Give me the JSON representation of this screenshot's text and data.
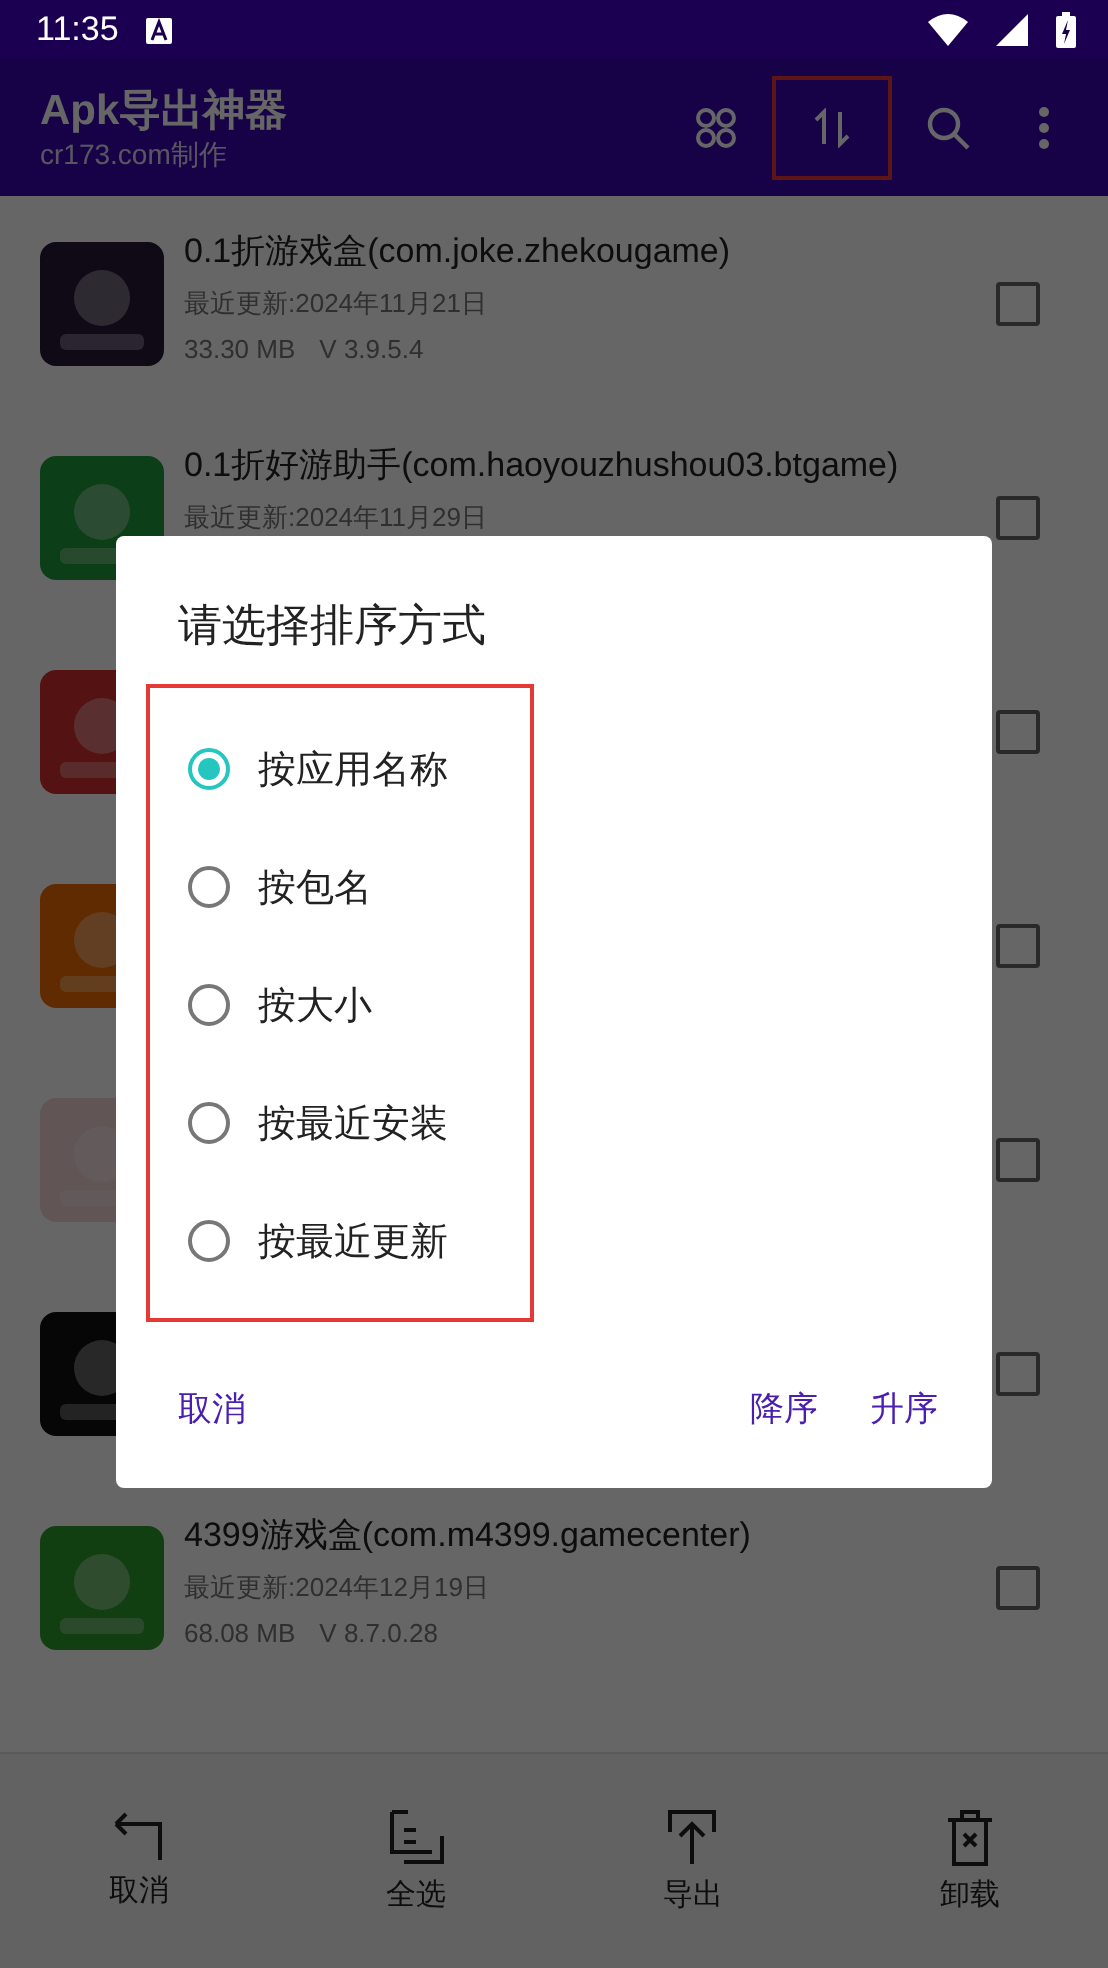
{
  "status_bar": {
    "time": "11:35"
  },
  "app_bar": {
    "title": "Apk导出神器",
    "subtitle": "cr173.com制作"
  },
  "apps": [
    {
      "name": "0.1折游戏盒(com.joke.zhekougame)",
      "updated": "最近更新:2024年11月21日",
      "size": "33.30 MB",
      "version": "V 3.9.5.4",
      "checked": false
    },
    {
      "name": "0.1折好游助手(com.haoyouzhushou03.btgame)",
      "updated": "最近更新:2024年11月29日",
      "checked": false
    },
    {
      "checked": false
    },
    {
      "checked": false
    },
    {
      "checked": false
    },
    {
      "checked": false
    },
    {
      "name": "4399游戏盒(com.m4399.gamecenter)",
      "updated": "最近更新:2024年12月19日",
      "size": "68.08 MB",
      "version": "V 8.7.0.28",
      "checked": false
    }
  ],
  "bottom_bar": [
    {
      "kind": "back",
      "label": "取消"
    },
    {
      "kind": "select_all",
      "label": "全选"
    },
    {
      "kind": "export",
      "label": "导出"
    },
    {
      "kind": "uninstall",
      "label": "卸载"
    }
  ],
  "sort_dialog": {
    "title": "请选择排序方式",
    "options": [
      {
        "label": "按应用名称",
        "selected": true
      },
      {
        "label": "按包名",
        "selected": false
      },
      {
        "label": "按大小",
        "selected": false
      },
      {
        "label": "按最近安装",
        "selected": false
      },
      {
        "label": "按最近更新",
        "selected": false
      }
    ],
    "cancel": "取消",
    "descending": "降序",
    "ascending": "升序"
  }
}
